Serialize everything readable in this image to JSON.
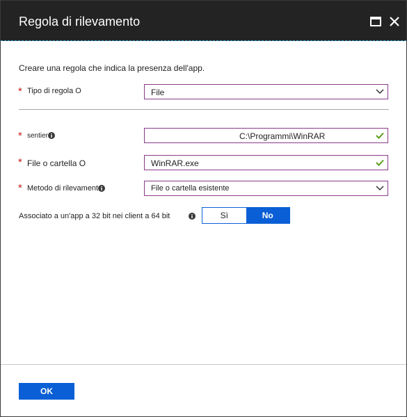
{
  "dialog": {
    "title": "Regola di rilevamento"
  },
  "intro": "Creare una regola che indica la presenza dell'app.",
  "rule_type": {
    "label": "Tipo di regola O",
    "value": "File"
  },
  "path": {
    "label": "sentier",
    "value": "C:\\Programmi\\WinRAR"
  },
  "file_or_folder": {
    "label": "File o cartella O",
    "value": "WinRAR.exe"
  },
  "detection_method": {
    "label": "Metodo di rilevament",
    "value": "File o cartella esistente"
  },
  "associated_32bit": {
    "label": "Associato a un'app a 32 bit nei client a 64 bit",
    "options": [
      "Sì",
      "No"
    ],
    "selected": "No"
  },
  "footer": {
    "ok_label": "OK"
  },
  "colors": {
    "titlebar": "#232323",
    "accent": "#0a5fd6",
    "required": "#c31b1b",
    "valid": "#5a9e1a",
    "field_border": "#8a3a8a"
  },
  "icons": {
    "maximize": "maximize-icon",
    "close": "close-icon",
    "info": "info-icon",
    "chevron": "chevron-down-icon",
    "check": "checkmark-icon"
  }
}
